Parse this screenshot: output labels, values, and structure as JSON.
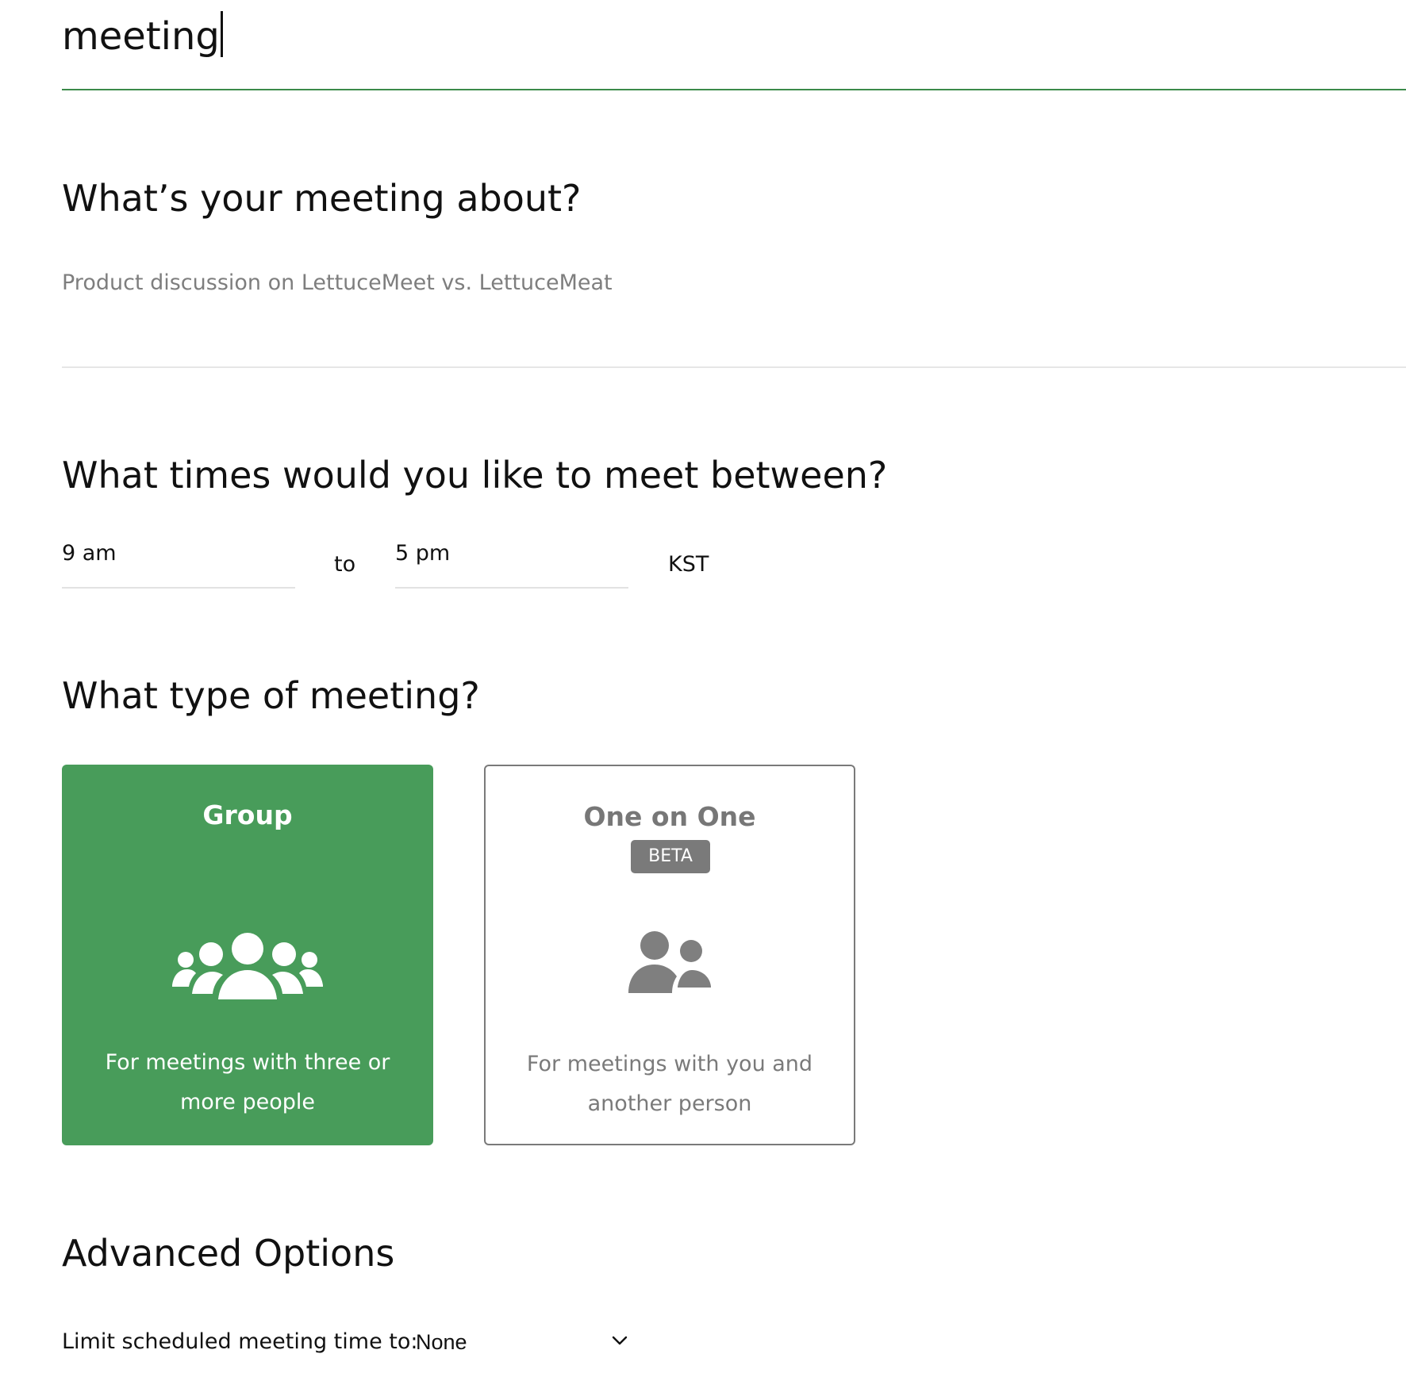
{
  "title": {
    "value": "meeting"
  },
  "description": {
    "heading": "What’s your meeting about?",
    "placeholder": "Product discussion on LettuceMeet vs. LettuceMeat"
  },
  "times": {
    "heading": "What times would you like to meet between?",
    "start": "9 am",
    "separator": "to",
    "end": "5 pm",
    "timezone": "KST"
  },
  "meeting_type": {
    "heading": "What type of meeting?",
    "options": [
      {
        "title": "Group",
        "description": "For meetings with three or more people",
        "icon": "group-people-icon",
        "selected": true
      },
      {
        "title": "One on One",
        "badge": "BETA",
        "description": "For meetings with you and another person",
        "icon": "two-people-icon",
        "selected": false
      }
    ]
  },
  "advanced": {
    "heading": "Advanced Options",
    "limit_label": "Limit scheduled meeting time to:",
    "limit_value": "None",
    "limit_icon": "chevron-down-icon"
  },
  "colors": {
    "accent": "#489c5a",
    "underline_active": "#3b8a4a",
    "muted": "#7a7a7a"
  }
}
